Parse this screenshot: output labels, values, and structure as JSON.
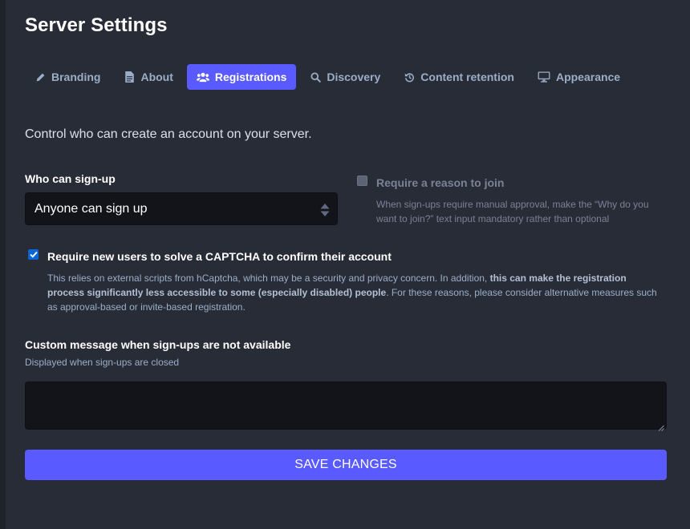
{
  "page": {
    "title": "Server Settings"
  },
  "tabs": [
    {
      "label": "Branding",
      "icon": "pencil-icon",
      "active": false
    },
    {
      "label": "About",
      "icon": "document-icon",
      "active": false
    },
    {
      "label": "Registrations",
      "icon": "users-icon",
      "active": true
    },
    {
      "label": "Discovery",
      "icon": "search-icon",
      "active": false
    },
    {
      "label": "Content retention",
      "icon": "history-icon",
      "active": false
    },
    {
      "label": "Appearance",
      "icon": "desktop-icon",
      "active": false
    }
  ],
  "lead": "Control who can create an account on your server.",
  "signup": {
    "label": "Who can sign-up",
    "value": "Anyone can sign up"
  },
  "reason": {
    "label": "Require a reason to join",
    "hint": "When sign-ups require manual approval, make the “Why do you want to join?” text input mandatory rather than optional",
    "checked": false,
    "disabled": true
  },
  "captcha": {
    "label": "Require new users to solve a CAPTCHA to confirm their account",
    "hint_part1": "This relies on external scripts from hCaptcha, which may be a security and privacy concern. In addition, ",
    "hint_bold": "this can make the registration process significantly less accessible to some (especially disabled) people",
    "hint_part2": ". For these reasons, please consider alternative measures such as approval-based or invite-based registration.",
    "checked": true
  },
  "closed_message": {
    "label": "Custom message when sign-ups are not available",
    "hint": "Displayed when sign-ups are closed",
    "value": ""
  },
  "save_button": {
    "label": "SAVE CHANGES"
  },
  "colors": {
    "background": "#282c37",
    "accent": "#595aff",
    "input_bg": "#131419",
    "muted_text": "#9baec8"
  }
}
